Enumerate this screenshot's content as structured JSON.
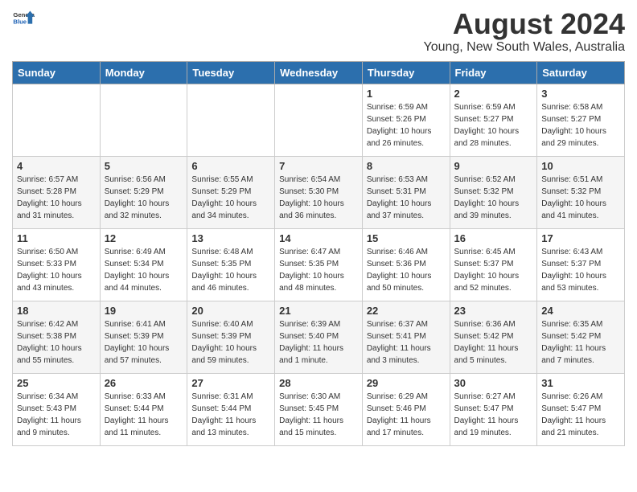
{
  "header": {
    "logo_line1": "General",
    "logo_line2": "Blue",
    "month_year": "August 2024",
    "location": "Young, New South Wales, Australia"
  },
  "weekdays": [
    "Sunday",
    "Monday",
    "Tuesday",
    "Wednesday",
    "Thursday",
    "Friday",
    "Saturday"
  ],
  "weeks": [
    [
      {
        "day": "",
        "info": ""
      },
      {
        "day": "",
        "info": ""
      },
      {
        "day": "",
        "info": ""
      },
      {
        "day": "",
        "info": ""
      },
      {
        "day": "1",
        "info": "Sunrise: 6:59 AM\nSunset: 5:26 PM\nDaylight: 10 hours\nand 26 minutes."
      },
      {
        "day": "2",
        "info": "Sunrise: 6:59 AM\nSunset: 5:27 PM\nDaylight: 10 hours\nand 28 minutes."
      },
      {
        "day": "3",
        "info": "Sunrise: 6:58 AM\nSunset: 5:27 PM\nDaylight: 10 hours\nand 29 minutes."
      }
    ],
    [
      {
        "day": "4",
        "info": "Sunrise: 6:57 AM\nSunset: 5:28 PM\nDaylight: 10 hours\nand 31 minutes."
      },
      {
        "day": "5",
        "info": "Sunrise: 6:56 AM\nSunset: 5:29 PM\nDaylight: 10 hours\nand 32 minutes."
      },
      {
        "day": "6",
        "info": "Sunrise: 6:55 AM\nSunset: 5:29 PM\nDaylight: 10 hours\nand 34 minutes."
      },
      {
        "day": "7",
        "info": "Sunrise: 6:54 AM\nSunset: 5:30 PM\nDaylight: 10 hours\nand 36 minutes."
      },
      {
        "day": "8",
        "info": "Sunrise: 6:53 AM\nSunset: 5:31 PM\nDaylight: 10 hours\nand 37 minutes."
      },
      {
        "day": "9",
        "info": "Sunrise: 6:52 AM\nSunset: 5:32 PM\nDaylight: 10 hours\nand 39 minutes."
      },
      {
        "day": "10",
        "info": "Sunrise: 6:51 AM\nSunset: 5:32 PM\nDaylight: 10 hours\nand 41 minutes."
      }
    ],
    [
      {
        "day": "11",
        "info": "Sunrise: 6:50 AM\nSunset: 5:33 PM\nDaylight: 10 hours\nand 43 minutes."
      },
      {
        "day": "12",
        "info": "Sunrise: 6:49 AM\nSunset: 5:34 PM\nDaylight: 10 hours\nand 44 minutes."
      },
      {
        "day": "13",
        "info": "Sunrise: 6:48 AM\nSunset: 5:35 PM\nDaylight: 10 hours\nand 46 minutes."
      },
      {
        "day": "14",
        "info": "Sunrise: 6:47 AM\nSunset: 5:35 PM\nDaylight: 10 hours\nand 48 minutes."
      },
      {
        "day": "15",
        "info": "Sunrise: 6:46 AM\nSunset: 5:36 PM\nDaylight: 10 hours\nand 50 minutes."
      },
      {
        "day": "16",
        "info": "Sunrise: 6:45 AM\nSunset: 5:37 PM\nDaylight: 10 hours\nand 52 minutes."
      },
      {
        "day": "17",
        "info": "Sunrise: 6:43 AM\nSunset: 5:37 PM\nDaylight: 10 hours\nand 53 minutes."
      }
    ],
    [
      {
        "day": "18",
        "info": "Sunrise: 6:42 AM\nSunset: 5:38 PM\nDaylight: 10 hours\nand 55 minutes."
      },
      {
        "day": "19",
        "info": "Sunrise: 6:41 AM\nSunset: 5:39 PM\nDaylight: 10 hours\nand 57 minutes."
      },
      {
        "day": "20",
        "info": "Sunrise: 6:40 AM\nSunset: 5:39 PM\nDaylight: 10 hours\nand 59 minutes."
      },
      {
        "day": "21",
        "info": "Sunrise: 6:39 AM\nSunset: 5:40 PM\nDaylight: 11 hours\nand 1 minute."
      },
      {
        "day": "22",
        "info": "Sunrise: 6:37 AM\nSunset: 5:41 PM\nDaylight: 11 hours\nand 3 minutes."
      },
      {
        "day": "23",
        "info": "Sunrise: 6:36 AM\nSunset: 5:42 PM\nDaylight: 11 hours\nand 5 minutes."
      },
      {
        "day": "24",
        "info": "Sunrise: 6:35 AM\nSunset: 5:42 PM\nDaylight: 11 hours\nand 7 minutes."
      }
    ],
    [
      {
        "day": "25",
        "info": "Sunrise: 6:34 AM\nSunset: 5:43 PM\nDaylight: 11 hours\nand 9 minutes."
      },
      {
        "day": "26",
        "info": "Sunrise: 6:33 AM\nSunset: 5:44 PM\nDaylight: 11 hours\nand 11 minutes."
      },
      {
        "day": "27",
        "info": "Sunrise: 6:31 AM\nSunset: 5:44 PM\nDaylight: 11 hours\nand 13 minutes."
      },
      {
        "day": "28",
        "info": "Sunrise: 6:30 AM\nSunset: 5:45 PM\nDaylight: 11 hours\nand 15 minutes."
      },
      {
        "day": "29",
        "info": "Sunrise: 6:29 AM\nSunset: 5:46 PM\nDaylight: 11 hours\nand 17 minutes."
      },
      {
        "day": "30",
        "info": "Sunrise: 6:27 AM\nSunset: 5:47 PM\nDaylight: 11 hours\nand 19 minutes."
      },
      {
        "day": "31",
        "info": "Sunrise: 6:26 AM\nSunset: 5:47 PM\nDaylight: 11 hours\nand 21 minutes."
      }
    ]
  ]
}
